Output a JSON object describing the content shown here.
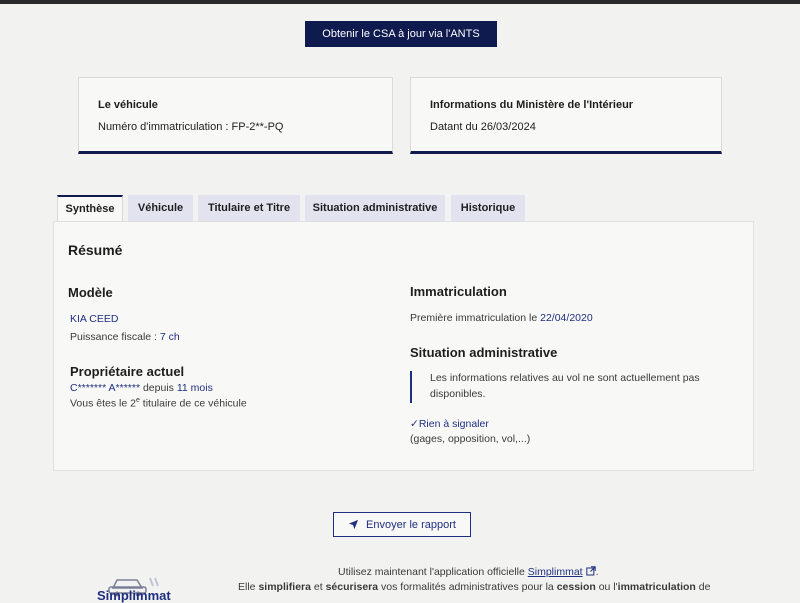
{
  "header": {
    "csa_button": "Obtenir le CSA à jour via l'ANTS"
  },
  "vehicle_card": {
    "title": "Le véhicule",
    "value": "Numéro d'immatriculation : FP-2**-PQ"
  },
  "ministry_card": {
    "title": "Informations du Ministère de l'Intérieur",
    "value": "Datant du 26/03/2024"
  },
  "tabs": [
    {
      "label": "Synthèse",
      "active": true
    },
    {
      "label": "Véhicule"
    },
    {
      "label": "Titulaire et Titre"
    },
    {
      "label": "Situation administrative"
    },
    {
      "label": "Historique"
    }
  ],
  "resume": {
    "title": "Résumé",
    "model": {
      "heading": "Modèle",
      "name": "KIA CEED",
      "power_label": "Puissance fiscale : ",
      "power_value": "7 ch"
    },
    "owner": {
      "heading": "Propriétaire actuel",
      "name": "C******* A******",
      "since_label": " depuis ",
      "since_value": "11 mois",
      "rank_prefix": "Vous êtes le 2",
      "rank_sup": "e",
      "rank_suffix": " titulaire de ce véhicule"
    },
    "registration": {
      "heading": "Immatriculation",
      "first_label": "Première immatriculation le ",
      "first_date": "22/04/2020"
    },
    "admin": {
      "heading": "Situation administrative",
      "theft_line1": "Les informations relatives au vol ne sont actuellement pas",
      "theft_line2": "disponibles.",
      "status_check": "✓",
      "status": "Rien à signaler",
      "status_detail": "(gages, opposition, vol,...)"
    }
  },
  "send_button": {
    "label": "Envoyer le rapport",
    "icon": "send-icon"
  },
  "footer": {
    "line1_prefix": "Utilisez maintenant l'application officielle ",
    "line1_link": "Simplimmat",
    "line1_suffix": ".",
    "line2_a": "Elle ",
    "line2_b": "simplifiera",
    "line2_c": " et ",
    "line2_d": "sécurisera",
    "line2_e": " vos formalités administratives pour la ",
    "line2_f": "cession",
    "line2_g": " ou l'",
    "line2_h": "immatriculation",
    "line2_i": " de",
    "logo_text": "Simplimmat"
  },
  "colors": {
    "navy": "#0f1b4f",
    "link": "#1f2f80",
    "tab": "#e3e3f0"
  }
}
